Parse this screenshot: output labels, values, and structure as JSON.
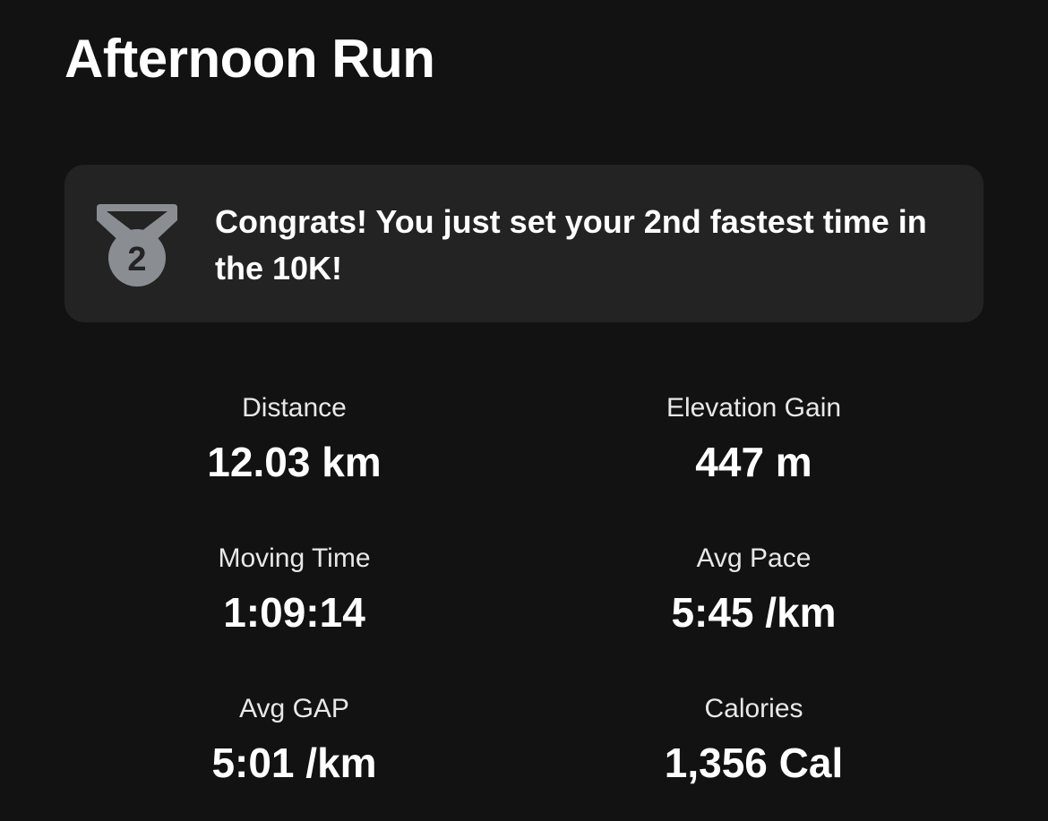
{
  "activity": {
    "title": "Afternoon Run"
  },
  "achievement": {
    "icon": "medal-icon",
    "rank": "2",
    "text": "Congrats! You just set your 2nd fastest time in the 10K!"
  },
  "stats": [
    {
      "label": "Distance",
      "value": "12.03 km"
    },
    {
      "label": "Elevation Gain",
      "value": "447 m"
    },
    {
      "label": "Moving Time",
      "value": "1:09:14"
    },
    {
      "label": "Avg Pace",
      "value": "5:45 /km"
    },
    {
      "label": "Avg GAP",
      "value": "5:01 /km"
    },
    {
      "label": "Calories",
      "value": "1,356 Cal"
    }
  ],
  "colors": {
    "background": "#121212",
    "card": "#232323",
    "medal": "#8a8e92",
    "text": "#ffffff"
  }
}
